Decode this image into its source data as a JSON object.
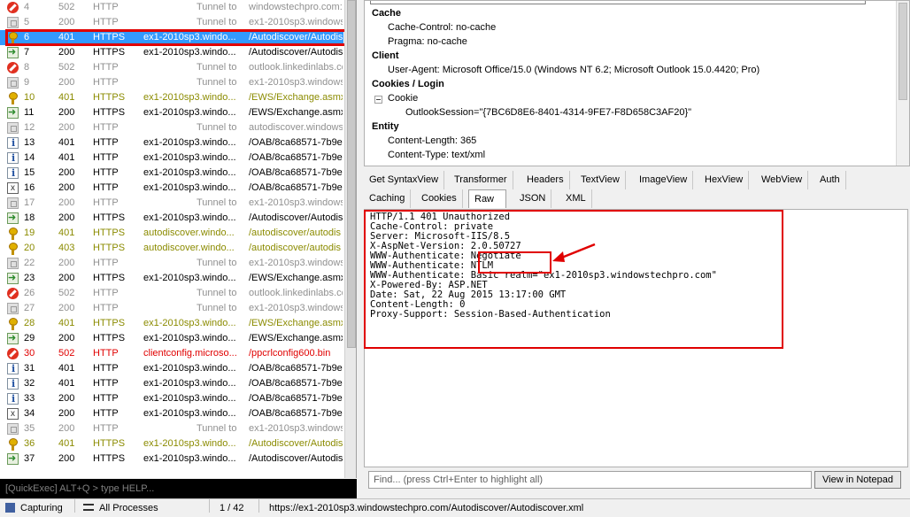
{
  "sessions": [
    {
      "num": "4",
      "result": "502",
      "protocol": "HTTP",
      "host": "Tunnel to",
      "url": "windowstechpro.com:",
      "type": "tunnel",
      "icon": "block-icon"
    },
    {
      "num": "5",
      "result": "200",
      "protocol": "HTTP",
      "host": "Tunnel to",
      "url": "ex1-2010sp3.windows",
      "type": "tunnel",
      "icon": "lock-icon"
    },
    {
      "num": "6",
      "result": "401",
      "protocol": "HTTPS",
      "host": "ex1-2010sp3.windo...",
      "url": "/Autodiscover/Autodis",
      "type": "selected",
      "icon": "key-icon"
    },
    {
      "num": "7",
      "result": "200",
      "protocol": "HTTPS",
      "host": "ex1-2010sp3.windo...",
      "url": "/Autodiscover/Autodis",
      "type": "normal",
      "icon": "arrow-icon"
    },
    {
      "num": "8",
      "result": "502",
      "protocol": "HTTP",
      "host": "Tunnel to",
      "url": "outlook.linkedinlabs.co",
      "type": "tunnel",
      "icon": "block-icon"
    },
    {
      "num": "9",
      "result": "200",
      "protocol": "HTTP",
      "host": "Tunnel to",
      "url": "ex1-2010sp3.windows",
      "type": "tunnel",
      "icon": "lock-icon"
    },
    {
      "num": "10",
      "result": "401",
      "protocol": "HTTPS",
      "host": "ex1-2010sp3.windo...",
      "url": "/EWS/Exchange.asmx",
      "type": "auth",
      "icon": "key-icon"
    },
    {
      "num": "11",
      "result": "200",
      "protocol": "HTTPS",
      "host": "ex1-2010sp3.windo...",
      "url": "/EWS/Exchange.asmx",
      "type": "normal",
      "icon": "arrow-icon"
    },
    {
      "num": "12",
      "result": "200",
      "protocol": "HTTP",
      "host": "Tunnel to",
      "url": "autodiscover.windows",
      "type": "tunnel",
      "icon": "lock-icon"
    },
    {
      "num": "13",
      "result": "401",
      "protocol": "HTTP",
      "host": "ex1-2010sp3.windo...",
      "url": "/OAB/8ca68571-7b9e",
      "type": "normal",
      "icon": "info-icon"
    },
    {
      "num": "14",
      "result": "401",
      "protocol": "HTTP",
      "host": "ex1-2010sp3.windo...",
      "url": "/OAB/8ca68571-7b9e",
      "type": "normal",
      "icon": "info-icon"
    },
    {
      "num": "15",
      "result": "200",
      "protocol": "HTTP",
      "host": "ex1-2010sp3.windo...",
      "url": "/OAB/8ca68571-7b9e",
      "type": "normal",
      "icon": "info-icon"
    },
    {
      "num": "16",
      "result": "200",
      "protocol": "HTTP",
      "host": "ex1-2010sp3.windo...",
      "url": "/OAB/8ca68571-7b9e",
      "type": "normal",
      "icon": "xml-icon"
    },
    {
      "num": "17",
      "result": "200",
      "protocol": "HTTP",
      "host": "Tunnel to",
      "url": "ex1-2010sp3.windows",
      "type": "tunnel",
      "icon": "lock-icon"
    },
    {
      "num": "18",
      "result": "200",
      "protocol": "HTTPS",
      "host": "ex1-2010sp3.windo...",
      "url": "/Autodiscover/Autodis",
      "type": "normal",
      "icon": "arrow-icon"
    },
    {
      "num": "19",
      "result": "401",
      "protocol": "HTTPS",
      "host": "autodiscover.windo...",
      "url": "/autodiscover/autodis",
      "type": "auth",
      "icon": "key-icon"
    },
    {
      "num": "20",
      "result": "403",
      "protocol": "HTTPS",
      "host": "autodiscover.windo...",
      "url": "/autodiscover/autodis",
      "type": "auth",
      "icon": "key-icon"
    },
    {
      "num": "22",
      "result": "200",
      "protocol": "HTTP",
      "host": "Tunnel to",
      "url": "ex1-2010sp3.windows",
      "type": "tunnel",
      "icon": "lock-icon"
    },
    {
      "num": "23",
      "result": "200",
      "protocol": "HTTPS",
      "host": "ex1-2010sp3.windo...",
      "url": "/EWS/Exchange.asmx",
      "type": "normal",
      "icon": "arrow-icon"
    },
    {
      "num": "26",
      "result": "502",
      "protocol": "HTTP",
      "host": "Tunnel to",
      "url": "outlook.linkedinlabs.co",
      "type": "tunnel",
      "icon": "block-icon"
    },
    {
      "num": "27",
      "result": "200",
      "protocol": "HTTP",
      "host": "Tunnel to",
      "url": "ex1-2010sp3.windows",
      "type": "tunnel",
      "icon": "lock-icon"
    },
    {
      "num": "28",
      "result": "401",
      "protocol": "HTTPS",
      "host": "ex1-2010sp3.windo...",
      "url": "/EWS/Exchange.asmx",
      "type": "auth",
      "icon": "key-icon"
    },
    {
      "num": "29",
      "result": "200",
      "protocol": "HTTPS",
      "host": "ex1-2010sp3.windo...",
      "url": "/EWS/Exchange.asmx",
      "type": "normal",
      "icon": "arrow-icon"
    },
    {
      "num": "30",
      "result": "502",
      "protocol": "HTTP",
      "host": "clientconfig.microso...",
      "url": "/ppcrlconfig600.bin",
      "type": "error",
      "icon": "error-icon"
    },
    {
      "num": "31",
      "result": "401",
      "protocol": "HTTP",
      "host": "ex1-2010sp3.windo...",
      "url": "/OAB/8ca68571-7b9e",
      "type": "normal",
      "icon": "info-icon"
    },
    {
      "num": "32",
      "result": "401",
      "protocol": "HTTP",
      "host": "ex1-2010sp3.windo...",
      "url": "/OAB/8ca68571-7b9e",
      "type": "normal",
      "icon": "info-icon"
    },
    {
      "num": "33",
      "result": "200",
      "protocol": "HTTP",
      "host": "ex1-2010sp3.windo...",
      "url": "/OAB/8ca68571-7b9e",
      "type": "normal",
      "icon": "info-icon"
    },
    {
      "num": "34",
      "result": "200",
      "protocol": "HTTP",
      "host": "ex1-2010sp3.windo...",
      "url": "/OAB/8ca68571-7b9e",
      "type": "normal",
      "icon": "xml-icon"
    },
    {
      "num": "35",
      "result": "200",
      "protocol": "HTTP",
      "host": "Tunnel to",
      "url": "ex1-2010sp3.windows",
      "type": "tunnel",
      "icon": "lock-icon"
    },
    {
      "num": "36",
      "result": "401",
      "protocol": "HTTPS",
      "host": "ex1-2010sp3.windo...",
      "url": "/Autodiscover/Autodis",
      "type": "auth",
      "icon": "key-icon"
    },
    {
      "num": "37",
      "result": "200",
      "protocol": "HTTPS",
      "host": "ex1-2010sp3.windo...",
      "url": "/Autodiscover/Autodis",
      "type": "normal",
      "icon": "arrow-icon"
    }
  ],
  "quickexec": "[QuickExec] ALT+Q > type HELP...",
  "statusbar": {
    "capturing": "Capturing",
    "processes": "All Processes",
    "count": "1 / 42",
    "url": "https://ex1-2010sp3.windowstechpro.com/Autodiscover/Autodiscover.xml"
  },
  "request": {
    "groups": [
      {
        "title": "Cache",
        "items": [
          "Cache-Control: no-cache",
          "Pragma: no-cache"
        ]
      },
      {
        "title": "Client",
        "items": [
          "User-Agent: Microsoft Office/15.0 (Windows NT 6.2; Microsoft Outlook 15.0.4420; Pro)"
        ]
      },
      {
        "title": "Cookies / Login",
        "cookie_label": "Cookie",
        "cookie_value": "OutlookSession=\"{7BC6D8E6-8401-4314-9FE7-F8D658C3AF20}\""
      },
      {
        "title": "Entity",
        "items": [
          "Content-Length: 365",
          "Content-Type: text/xml"
        ]
      }
    ]
  },
  "tabs_row1": [
    "Get SyntaxView",
    "Transformer",
    "Headers",
    "TextView",
    "ImageView",
    "HexView",
    "WebView",
    "Auth"
  ],
  "tabs_row2": [
    "Caching",
    "Cookies",
    "Raw",
    "JSON",
    "XML"
  ],
  "active_tab": "Raw",
  "response_lines": [
    "HTTP/1.1 401 Unauthorized",
    "Cache-Control: private",
    "Server: Microsoft-IIS/8.5",
    "X-AspNet-Version: 2.0.50727",
    "WWW-Authenticate: Negotiate",
    "WWW-Authenticate: NTLM",
    "WWW-Authenticate: Basic realm=\"ex1-2010sp3.windowstechpro.com\"",
    "X-Powered-By: ASP.NET",
    "Date: Sat, 22 Aug 2015 13:17:00 GMT",
    "Content-Length: 0",
    "Proxy-Support: Session-Based-Authentication"
  ],
  "find_placeholder": "Find... (press Ctrl+Enter to highlight all)",
  "notepad_button": "View in Notepad",
  "colors": {
    "highlight": "#e00000",
    "selected_row": "#3399ff",
    "auth_row": "#8b8b00",
    "tunnel_row": "#909090"
  }
}
